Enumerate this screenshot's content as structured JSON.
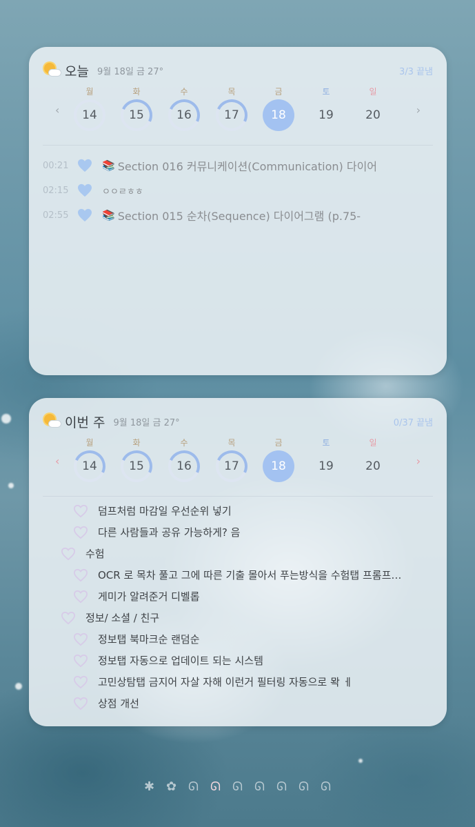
{
  "today_card": {
    "title": "오늘",
    "date": "9월 18일 금  27°",
    "count": "3/3 끝냄",
    "weather_icon": "partly-cloudy-icon",
    "prev_arrow": "‹",
    "next_arrow": "›",
    "weekdays": [
      "월",
      "화",
      "수",
      "목",
      "금",
      "토",
      "일"
    ],
    "days": [
      "14",
      "15",
      "16",
      "17",
      "18",
      "19",
      "20"
    ],
    "entries": [
      {
        "time": "00:21",
        "icon": "heart-icon",
        "emoji": "📚",
        "text": "Section 016 커뮤니케이션(Communication) 다이어"
      },
      {
        "time": "02:15",
        "icon": "heart-icon",
        "emoji": "",
        "text": "ㅇㅇㄹㅎㅎ"
      },
      {
        "time": "02:55",
        "icon": "heart-icon",
        "emoji": "📚",
        "text": "Section 015 순차(Sequence) 다이어그램 (p.75-"
      }
    ]
  },
  "week_card": {
    "title": "이번 주",
    "date": "9월 18일 금  27°",
    "count": "0/37 끝냄",
    "weather_icon": "partly-cloudy-icon",
    "prev_arrow": "‹",
    "next_arrow": "›",
    "weekdays": [
      "월",
      "화",
      "수",
      "목",
      "금",
      "토",
      "일"
    ],
    "days": [
      "14",
      "15",
      "16",
      "17",
      "18",
      "19",
      "20"
    ],
    "todos": [
      {
        "level": 1,
        "text": "덤프처럼 마감일 우선순위 넣기"
      },
      {
        "level": 1,
        "text": "다른 사람들과 공유 가능하게? 음"
      },
      {
        "level": 0,
        "text": "수험"
      },
      {
        "level": 1,
        "text": "OCR 로 목차 풀고 그에 따른 기출 몰아서 푸는방식을 수험탭 프롬프…"
      },
      {
        "level": 1,
        "text": "게미가 알려준거 디벨롭"
      },
      {
        "level": 0,
        "text": "정보/ 소셜 / 친구"
      },
      {
        "level": 1,
        "text": "정보탭 북마크순 랜덤순"
      },
      {
        "level": 1,
        "text": "정보탭 자동으로 업데이트 되는 시스템"
      },
      {
        "level": 1,
        "text": "고민상탐탭 금지어 자살 자해 이런거 필터링 자동으로 뫅  ㅔ"
      },
      {
        "level": 1,
        "text": "상점 개선"
      }
    ]
  },
  "pager": {
    "icons": [
      "star-icon",
      "flower-icon",
      "bunny-icon",
      "bunny-icon-active",
      "bunny-icon",
      "bunny-icon",
      "bunny-icon",
      "bunny-icon",
      "bunny-icon"
    ],
    "glyphs": [
      "✱",
      "✿",
      "ᘏ",
      "ᘏ",
      "ᘏ",
      "ᘏ",
      "ᘏ",
      "ᘏ",
      "ᘏ"
    ]
  },
  "colors": {
    "accent": "#a3c2f1",
    "heart_filled": "#a9c8f0",
    "heart_outline": "#d7cbe8",
    "sunday": "#e79aa5",
    "saturday": "#8eaee0"
  }
}
